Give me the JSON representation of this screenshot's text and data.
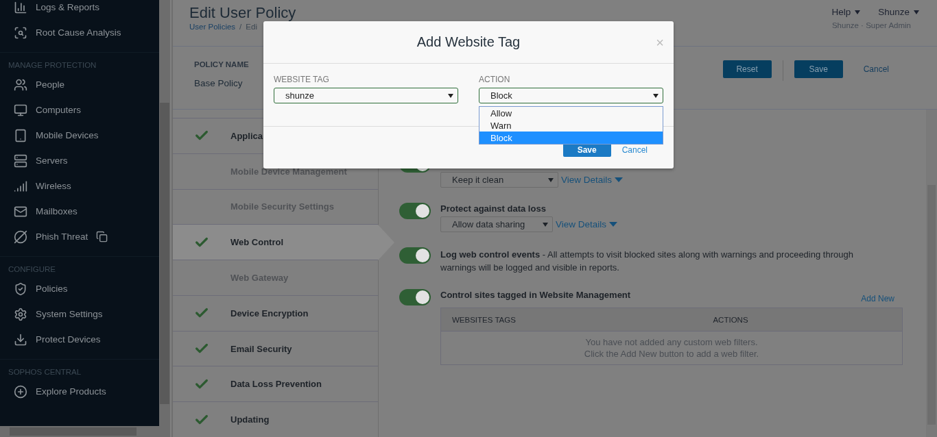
{
  "sidebar": {
    "top_items": [
      {
        "label": "Logs & Reports"
      },
      {
        "label": "Root Cause Analysis"
      }
    ],
    "sections": [
      {
        "heading": "MANAGE PROTECTION",
        "items": [
          {
            "label": "People"
          },
          {
            "label": "Computers"
          },
          {
            "label": "Mobile Devices"
          },
          {
            "label": "Servers"
          },
          {
            "label": "Wireless"
          },
          {
            "label": "Mailboxes"
          },
          {
            "label": "Phish Threat",
            "external": true
          }
        ]
      },
      {
        "heading": "CONFIGURE",
        "items": [
          {
            "label": "Policies"
          },
          {
            "label": "System Settings"
          },
          {
            "label": "Protect Devices"
          }
        ]
      },
      {
        "heading": "SOPHOS CENTRAL",
        "items": [
          {
            "label": "Explore Products"
          }
        ]
      }
    ]
  },
  "header": {
    "title": "Edit User Policy",
    "breadcrumb": [
      "User Policies",
      "/",
      "Edi"
    ],
    "menus": [
      "Help",
      "Shunze"
    ],
    "user_role": "Shunze · Super Admin"
  },
  "policy": {
    "name_label": "POLICY NAME",
    "name": "Base Policy",
    "buttons": [
      "Reset",
      "Save"
    ],
    "cancel": "Cancel"
  },
  "nav": [
    {
      "label": "Applica",
      "checked": true,
      "disabled": false,
      "selected": false
    },
    {
      "label": "Mobile Device Management",
      "checked": false,
      "disabled": true,
      "selected": false
    },
    {
      "label": "Mobile Security Settings",
      "checked": false,
      "disabled": true,
      "selected": false
    },
    {
      "label": "Web Control",
      "checked": true,
      "disabled": false,
      "selected": true
    },
    {
      "label": "Web Gateway",
      "checked": false,
      "disabled": true,
      "selected": false
    },
    {
      "label": "Device Encryption",
      "checked": true,
      "disabled": false,
      "selected": false
    },
    {
      "label": "Email Security",
      "checked": true,
      "disabled": false,
      "selected": false
    },
    {
      "label": "Data Loss Prevention",
      "checked": true,
      "disabled": false,
      "selected": false
    },
    {
      "label": "Updating",
      "checked": true,
      "disabled": false,
      "selected": false
    }
  ],
  "rules": [
    {
      "kind": "select",
      "on": true,
      "value": "Keep it clean",
      "link": "View Details"
    },
    {
      "kind": "select",
      "on": true,
      "label": "Protect against data loss",
      "value": "Allow data sharing",
      "link": "View Details"
    },
    {
      "kind": "text",
      "on": true,
      "label": "Log web control events",
      "text": "- All attempts to visit blocked sites along with warnings and proceeding through warnings will be logged and visible in reports."
    },
    {
      "kind": "table",
      "on": true,
      "label": "Control sites tagged in Website Management",
      "add": "Add New",
      "columns": [
        "WEBSITES TAGS",
        "ACTIONS"
      ],
      "empty": [
        "You have not added any custom web filters.",
        "Click the Add New button to add a web filter."
      ]
    }
  ],
  "dialog": {
    "title": "Add Website Tag",
    "close": "×",
    "tag_label": "WEBSITE TAG",
    "tag_value": "shunze",
    "action_label": "ACTION",
    "action_value": "Block",
    "options": [
      {
        "label": "Allow",
        "selected": false
      },
      {
        "label": "Warn",
        "selected": false
      },
      {
        "label": "Block",
        "selected": true
      }
    ],
    "save": "Save",
    "cancel": "Cancel"
  }
}
